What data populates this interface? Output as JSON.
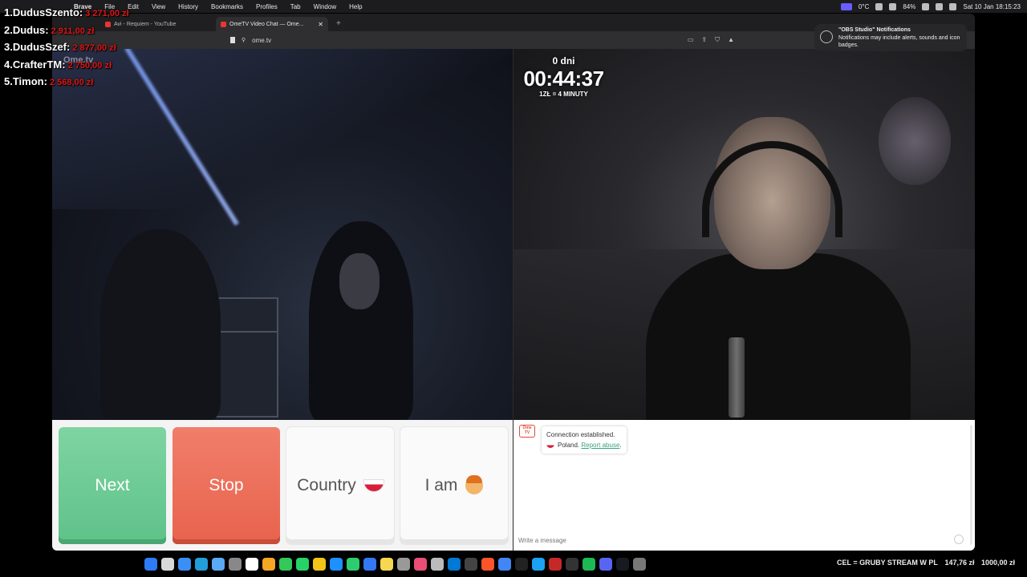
{
  "menubar": {
    "app_name": "Brave",
    "items": [
      "File",
      "Edit",
      "View",
      "History",
      "Bookmarks",
      "Profiles",
      "Tab",
      "Window",
      "Help"
    ],
    "temperature": "0°C",
    "battery": "84%",
    "datetime": "Sat 10 Jan  18:15:23"
  },
  "leaderboard": [
    {
      "label": "1.DudusSzento:",
      "amount": "3 271,00 zł"
    },
    {
      "label": "2.Dudus:",
      "amount": "2 911,00 zł"
    },
    {
      "label": "3.DudusSzef:",
      "amount": "2 877,00 zł"
    },
    {
      "label": "4.CrafterTM:",
      "amount": "2 750,00 zł"
    },
    {
      "label": "5.Timon:",
      "amount": "2 568,00 zł"
    }
  ],
  "browser": {
    "tabs": [
      {
        "title": "Avi - Requiem - YouTube",
        "active": false
      },
      {
        "title": "OmeTV Video Chat — Ome...",
        "active": true
      }
    ],
    "new_tab": "+",
    "url": "ome.tv"
  },
  "video": {
    "watermark": "Ome.tv"
  },
  "timer": {
    "days": "0 dni",
    "clock": "00:44:37",
    "rate": "1ZŁ = 4 MINUTY"
  },
  "controls": {
    "next_label": "Next",
    "stop_label": "Stop",
    "country_label": "Country",
    "iam_label": "I am"
  },
  "chat": {
    "logo_text": "Ome TV",
    "status_line": "Connection established.",
    "country": "Poland.",
    "report_link": "Report abuse",
    "input_placeholder": "Write a message"
  },
  "notification": {
    "title": "\"OBS Studio\" Notifications",
    "body": "Notifications may include alerts, sounds and icon badges."
  },
  "ticker": {
    "text": "CEL = GRUBY STREAM W PL",
    "current": "147,76 zł",
    "goal": "1000,00 zł"
  },
  "colors": {
    "next": "#5ec289",
    "stop": "#e8634d",
    "leaderboard_amount": "#e01515",
    "link": "#3aa57a"
  }
}
